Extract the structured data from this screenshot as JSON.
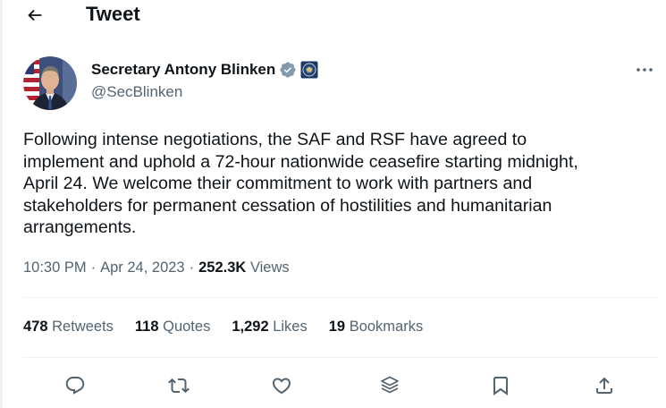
{
  "header": {
    "title": "Tweet",
    "back_icon": "arrow-left-icon"
  },
  "author": {
    "display_name": "Secretary Antony Blinken",
    "handle": "@SecBlinken",
    "verified_badge": "verified-badge-icon",
    "affiliation_badge": "government-seal-icon",
    "verified_color": "#829aab"
  },
  "tweet": {
    "text": "Following intense negotiations, the SAF and RSF have agreed to\nimplement and uphold a 72-hour nationwide ceasefire starting midnight,\nApril 24. We welcome their commitment to work with partners and\nstakeholders for permanent cessation of hostilities and humanitarian\narrangements.",
    "time": "10:30 PM",
    "separator": "·",
    "date": "Apr 24, 2023",
    "views_count": "252.3K",
    "views_label": "Views"
  },
  "stats": [
    {
      "count": "478",
      "label": "Retweets"
    },
    {
      "count": "118",
      "label": "Quotes"
    },
    {
      "count": "1,292",
      "label": "Likes"
    },
    {
      "count": "19",
      "label": "Bookmarks"
    }
  ],
  "actions": [
    "reply-icon",
    "retweet-icon",
    "like-icon",
    "layers-icon",
    "bookmark-icon",
    "share-icon"
  ],
  "colors": {
    "text_primary": "#0f1419",
    "text_secondary": "#536471",
    "divider": "#eff3f4"
  }
}
